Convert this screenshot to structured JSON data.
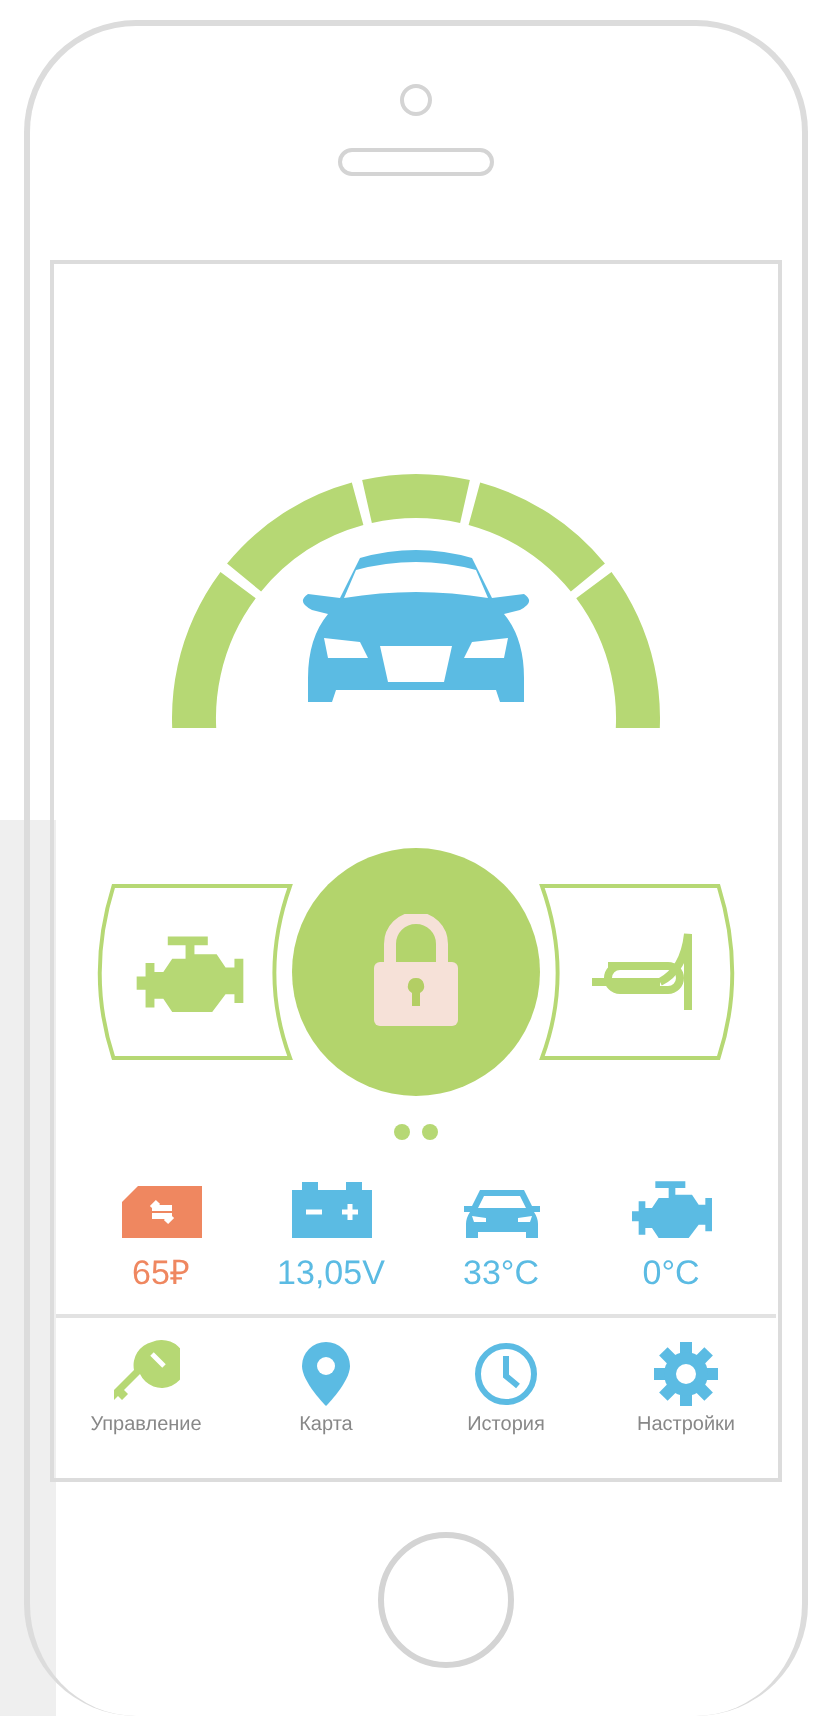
{
  "controls": [
    {
      "kind": "engine",
      "selected": false
    },
    {
      "kind": "lock",
      "selected": true
    },
    {
      "kind": "horn",
      "selected": false
    }
  ],
  "status": [
    {
      "kind": "balance",
      "value": "65₽",
      "color": "#ef8760"
    },
    {
      "kind": "battery",
      "value": "13,05V",
      "color": "#5bbbe3"
    },
    {
      "kind": "car",
      "value": "33°C",
      "color": "#5bbbe3"
    },
    {
      "kind": "engine",
      "value": "0°C",
      "color": "#5bbbe3"
    }
  ],
  "nav": [
    {
      "kind": "key",
      "label": "Управление",
      "selected": true
    },
    {
      "kind": "pin",
      "label": "Карта",
      "selected": false
    },
    {
      "kind": "clock",
      "label": "История",
      "selected": false
    },
    {
      "kind": "gear",
      "label": "Настройки",
      "selected": false
    }
  ]
}
